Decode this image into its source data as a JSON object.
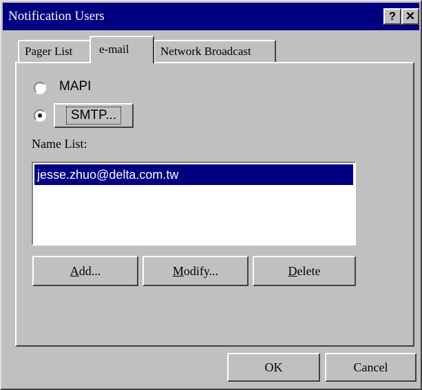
{
  "window": {
    "title": "Notification Users",
    "help_label": "?",
    "close_label": "✕"
  },
  "tabs": [
    {
      "label": "Pager List",
      "selected": false
    },
    {
      "label": "e-mail",
      "selected": true
    },
    {
      "label": "Network Broadcast",
      "selected": false
    }
  ],
  "email": {
    "mapi_label": "MAPI",
    "smtp_label": "SMTP...",
    "selected_option": "SMTP",
    "name_list_label": "Name List:",
    "names": [
      "jesse.zhuo@delta.com.tw"
    ],
    "selected_index": 0
  },
  "buttons": {
    "add_mnemonic": "A",
    "add_rest": "dd...",
    "modify_mnemonic": "M",
    "modify_rest": "odify...",
    "delete_mnemonic": "D",
    "delete_rest": "elete"
  },
  "footer": {
    "ok_label": "OK",
    "cancel_label": "Cancel"
  },
  "colors": {
    "titlebar": "#000080",
    "selection": "#000080",
    "face": "#c0c0c0"
  }
}
